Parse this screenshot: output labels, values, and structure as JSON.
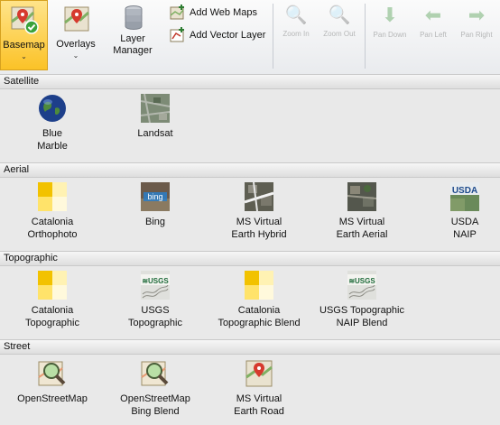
{
  "ribbon": {
    "basemap_label": "Basemap",
    "overlays_label": "Overlays",
    "layer_manager_label": "Layer\nManager",
    "add_web_maps_label": "Add Web Maps",
    "add_vector_layer_label": "Add Vector Layer",
    "disabled_buttons": [
      "Zoom In",
      "Zoom Out",
      "Pan Down",
      "Pan Left",
      "Pan Right"
    ]
  },
  "categories": [
    {
      "title": "Satellite",
      "items": [
        {
          "label": "Blue\nMarble",
          "icon": "globe-icon"
        },
        {
          "label": "Landsat",
          "icon": "satellite-photo-icon"
        }
      ]
    },
    {
      "title": "Aerial",
      "items": [
        {
          "label": "Catalonia\nOrthophoto",
          "icon": "yellow-squares-icon"
        },
        {
          "label": "Bing",
          "icon": "bing-icon"
        },
        {
          "label": "MS Virtual\nEarth Hybrid",
          "icon": "aerial-hybrid-icon"
        },
        {
          "label": "MS Virtual\nEarth Aerial",
          "icon": "aerial-photo-icon"
        },
        {
          "label": "USDA\nNAIP",
          "icon": "usda-icon"
        }
      ]
    },
    {
      "title": "Topographic",
      "items": [
        {
          "label": "Catalonia\nTopographic",
          "icon": "yellow-squares-icon"
        },
        {
          "label": "USGS\nTopographic",
          "icon": "usgs-icon"
        },
        {
          "label": "Catalonia\nTopographic Blend",
          "icon": "yellow-squares-icon"
        },
        {
          "label": "USGS Topographic\nNAIP Blend",
          "icon": "usgs-icon"
        }
      ]
    },
    {
      "title": "Street",
      "items": [
        {
          "label": "OpenStreetMap",
          "icon": "osm-magnifier-icon"
        },
        {
          "label": "OpenStreetMap\nBing Blend",
          "icon": "osm-magnifier-icon"
        },
        {
          "label": "MS Virtual\nEarth Road",
          "icon": "road-map-pin-icon"
        }
      ]
    }
  ],
  "icon_text": {
    "bing": "bing",
    "usda": "USDA",
    "usgs": "≋USGS"
  }
}
